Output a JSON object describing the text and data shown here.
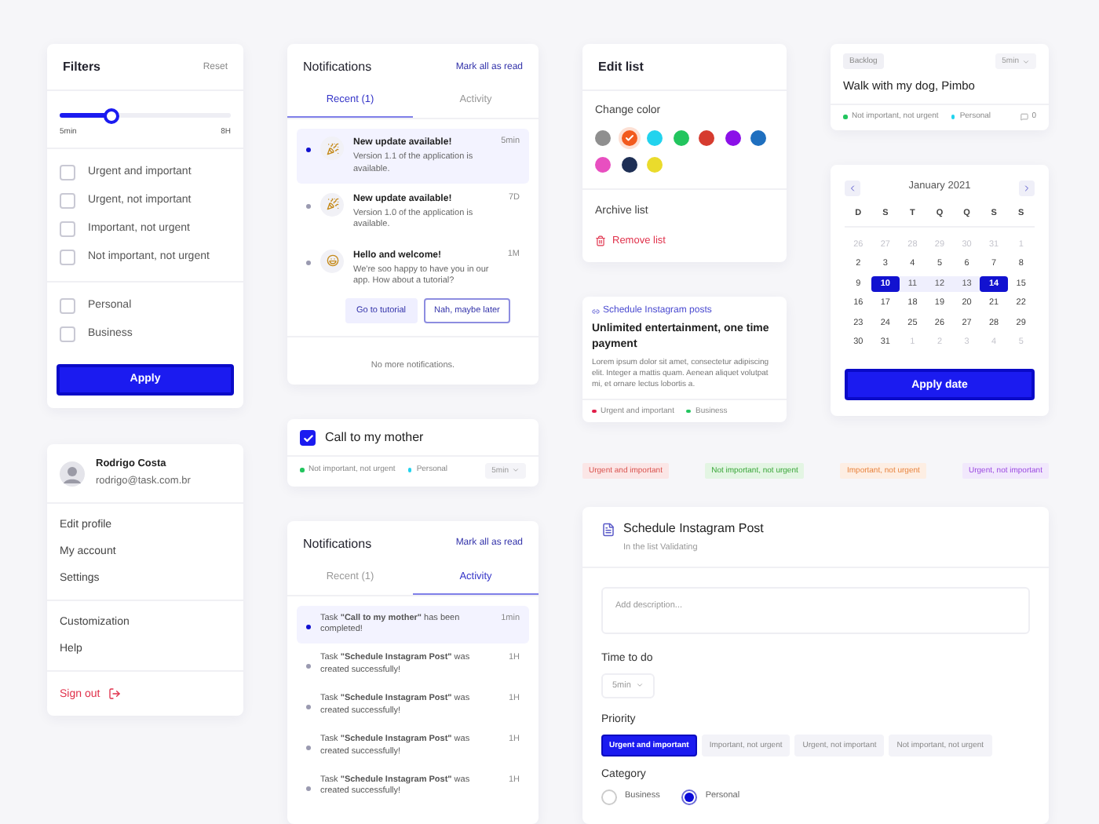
{
  "filters": {
    "title": "Filters",
    "reset": "Reset",
    "slider": {
      "level": 0.3,
      "min_label": "5min",
      "max_label": "8H"
    },
    "priorities": [
      {
        "label": "Urgent and important",
        "checked": false
      },
      {
        "label": "Urgent, not important",
        "checked": false
      },
      {
        "label": "Important, not urgent",
        "checked": false
      },
      {
        "label": "Not important, not urgent",
        "checked": false
      }
    ],
    "categories": [
      {
        "label": "Personal",
        "checked": false
      },
      {
        "label": "Business",
        "checked": false
      }
    ],
    "apply": "Apply"
  },
  "profile": {
    "name": "Rodrigo Costa",
    "email": "rodrigo@task.com.br",
    "menu_groups": [
      [
        "Edit profile",
        "My account",
        "Settings"
      ],
      [
        "Customization",
        "Help"
      ]
    ],
    "sign_out": "Sign out"
  },
  "notifications_recent": {
    "title": "Notifications",
    "mark_all": "Mark all as read",
    "tabs": [
      {
        "label": "Recent (1)",
        "selected": true
      },
      {
        "label": "Activity",
        "selected": false
      }
    ],
    "items": [
      {
        "kind": "party",
        "title": "New update available!",
        "body": "Version 1.1 of the application is available.",
        "time": "5min",
        "unread": true
      },
      {
        "kind": "party",
        "title": "New update available!",
        "body": "Version 1.0 of the application is available.",
        "time": "7D",
        "unread": false
      },
      {
        "kind": "smile",
        "title": "Hello and welcome!",
        "body": "We're soo happy to have you in our app. How about a tutorial?",
        "time": "1M",
        "unread": false,
        "actions": [
          "Go to tutorial",
          "Nah, maybe later"
        ]
      }
    ],
    "footer": "No more notifications."
  },
  "task_card": {
    "title": "Call to my mother",
    "checked": true,
    "time": "5min",
    "tags": [
      {
        "label": "Not important, not urgent",
        "color": "#22c55e"
      },
      {
        "label": "Personal",
        "color": "#22d3ee"
      }
    ]
  },
  "notifications_activity": {
    "title": "Notifications",
    "mark_all": "Mark all as read",
    "tabs": [
      {
        "label": "Recent (1)",
        "selected": false
      },
      {
        "label": "Activity",
        "selected": true
      }
    ],
    "items": [
      {
        "text": "Task **\"Call to my mother\"** has been completed!",
        "time": "1min",
        "unread": true
      },
      {
        "text": "Task **\"Schedule Instagram Post\"** was created successfully!",
        "time": "1H",
        "unread": false
      },
      {
        "text": "Task **\"Schedule Instagram Post\"** was created successfully!",
        "time": "1H",
        "unread": false
      },
      {
        "text": "Task **\"Schedule Instagram Post\"** was created successfully!",
        "time": "1H",
        "unread": false
      },
      {
        "text": "Task **\"Schedule Instagram Post\"** was created successfully!",
        "time": "1H",
        "unread": false
      }
    ]
  },
  "edit_list": {
    "title": "Edit list",
    "change_color": "Change color",
    "colors": [
      {
        "color": "#8f8f8f",
        "selected": false
      },
      {
        "color": "#f25a1d",
        "selected": true
      },
      {
        "color": "#22d3ee",
        "selected": false
      },
      {
        "color": "#22c55e",
        "selected": false
      },
      {
        "color": "#d63b2f",
        "selected": false
      },
      {
        "color": "#8b10e8",
        "selected": false
      },
      {
        "color": "#1f6fbf",
        "selected": false
      },
      {
        "color": "#e84fc0",
        "selected": false
      },
      {
        "color": "#1e2f55",
        "selected": false
      },
      {
        "color": "#eadb2c",
        "selected": false
      }
    ],
    "archive": "Archive list",
    "remove": "Remove list"
  },
  "backlog_card": {
    "list": "Backlog",
    "time": "5min",
    "title": "Walk with my dog, Pimbo",
    "comments": "0",
    "tags": [
      {
        "label": "Not important, not urgent",
        "color": "#22c55e"
      },
      {
        "label": "Personal",
        "color": "#22d3ee"
      }
    ]
  },
  "instagram_card": {
    "link": "Schedule Instagram posts",
    "title": "Unlimited entertainment, one time payment",
    "body": "Lorem ipsum dolor sit amet, consectetur adipiscing elit. Integer a mattis quam. Aenean aliquet volutpat mi, et ornare lectus lobortis a.",
    "tags": [
      {
        "label": "Urgent and important",
        "color": "#e11d48"
      },
      {
        "label": "Business",
        "color": "#22c55e"
      }
    ]
  },
  "calendar": {
    "month": "January 2021",
    "weekdays": [
      "D",
      "S",
      "T",
      "Q",
      "Q",
      "S",
      "S"
    ],
    "weeks": [
      [
        {
          "day": "26",
          "kind": "outside"
        },
        {
          "day": "27",
          "kind": "outside"
        },
        {
          "day": "28",
          "kind": "outside"
        },
        {
          "day": "29",
          "kind": "outside"
        },
        {
          "day": "30",
          "kind": "outside"
        },
        {
          "day": "31",
          "kind": "outside"
        },
        {
          "day": "1",
          "kind": "outside"
        }
      ],
      [
        {
          "day": "2",
          "kind": "normal"
        },
        {
          "day": "3",
          "kind": "normal"
        },
        {
          "day": "4",
          "kind": "normal"
        },
        {
          "day": "5",
          "kind": "normal"
        },
        {
          "day": "6",
          "kind": "normal"
        },
        {
          "day": "7",
          "kind": "normal"
        },
        {
          "day": "8",
          "kind": "normal"
        }
      ],
      [
        {
          "day": "9",
          "kind": "normal"
        },
        {
          "day": "10",
          "kind": "edge"
        },
        {
          "day": "11",
          "kind": "range"
        },
        {
          "day": "12",
          "kind": "range"
        },
        {
          "day": "13",
          "kind": "range"
        },
        {
          "day": "14",
          "kind": "edge"
        },
        {
          "day": "15",
          "kind": "normal"
        }
      ],
      [
        {
          "day": "16",
          "kind": "normal"
        },
        {
          "day": "17",
          "kind": "normal"
        },
        {
          "day": "18",
          "kind": "normal"
        },
        {
          "day": "19",
          "kind": "normal"
        },
        {
          "day": "20",
          "kind": "normal"
        },
        {
          "day": "21",
          "kind": "normal"
        },
        {
          "day": "22",
          "kind": "normal"
        }
      ],
      [
        {
          "day": "23",
          "kind": "normal"
        },
        {
          "day": "24",
          "kind": "normal"
        },
        {
          "day": "25",
          "kind": "normal"
        },
        {
          "day": "26",
          "kind": "normal"
        },
        {
          "day": "27",
          "kind": "normal"
        },
        {
          "day": "28",
          "kind": "normal"
        },
        {
          "day": "29",
          "kind": "normal"
        }
      ],
      [
        {
          "day": "30",
          "kind": "normal"
        },
        {
          "day": "31",
          "kind": "normal"
        },
        {
          "day": "1",
          "kind": "outside"
        },
        {
          "day": "2",
          "kind": "outside"
        },
        {
          "day": "3",
          "kind": "outside"
        },
        {
          "day": "4",
          "kind": "outside"
        },
        {
          "day": "5",
          "kind": "outside"
        }
      ]
    ],
    "apply": "Apply date"
  },
  "tags": [
    {
      "label": "Urgent and important",
      "kind": "urgent"
    },
    {
      "label": "Not important, not urgent",
      "kind": "low"
    },
    {
      "label": "Important, not urgent",
      "kind": "important"
    },
    {
      "label": "Urgent, not important",
      "kind": "delegate"
    }
  ],
  "schedule": {
    "title": "Schedule Instagram Post",
    "subtitle": "In the list Validating",
    "description_placeholder": "Add description...",
    "time_label": "Time to do",
    "time": "5min",
    "priority_label": "Priority",
    "priorities": [
      {
        "label": "Urgent and important",
        "selected": true
      },
      {
        "label": "Important, not urgent",
        "selected": false
      },
      {
        "label": "Urgent, not important",
        "selected": false
      },
      {
        "label": "Not important, not urgent",
        "selected": false
      }
    ],
    "category_label": "Category",
    "categories": [
      {
        "label": "Business",
        "selected": false
      },
      {
        "label": "Personal",
        "selected": true
      }
    ]
  }
}
